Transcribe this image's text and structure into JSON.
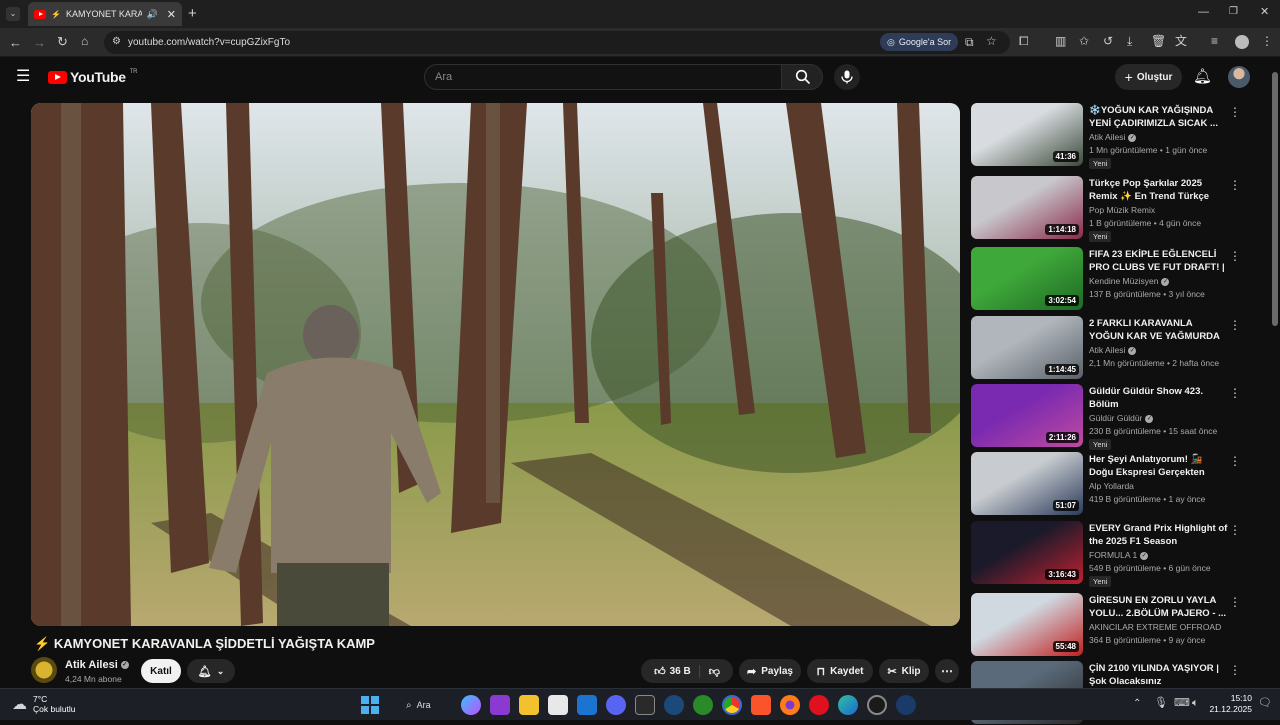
{
  "browser": {
    "tab_title": "KAMYONET KARAVANLA",
    "url": "youtube.com/watch?v=cupGZixFgTo",
    "google_ask_label": "Google'a Sor"
  },
  "youtube": {
    "logo_text": "YouTube",
    "region": "TR",
    "search_placeholder": "Ara",
    "create_label": "Oluştur"
  },
  "video": {
    "title_icon": "⚡",
    "title": "KAMYONET KARAVANLA ŞİDDETLİ YAĞIŞTA KAMP",
    "channel_name": "Atik Ailesi",
    "subscribers": "4,24 Mn abone",
    "join_label": "Katıl",
    "likes": "36 B",
    "share_label": "Paylaş",
    "save_label": "Kaydet",
    "clip_label": "Klip"
  },
  "recommendations": [
    {
      "title": "❄️YOĞUN KAR YAĞIŞINDA YENİ ÇADIRIMIZLA SICAK ...",
      "channel": "Atik Ailesi",
      "verified": true,
      "meta": "1 Mn görüntüleme • 1 gün önce",
      "badge": "Yeni",
      "duration": "41:36",
      "thumb_colors": [
        "#d8dce0",
        "#3c4a3a"
      ]
    },
    {
      "title": "Türkçe Pop Şarkılar 2025 Remix ✨ En Trend Türkçe Şarkılar ...",
      "channel": "Pop Müzik Remix",
      "verified": false,
      "meta": "1 B görüntüleme • 4 gün önce",
      "badge": "Yeni",
      "duration": "1:14:18",
      "thumb_colors": [
        "#c8c8cc",
        "#8a2a4a"
      ]
    },
    {
      "title": "FIFA 23 EKİPLE EĞLENCELİ PRO CLUBS VE FUT DRAFT! | ...",
      "channel": "Kendine Müzisyen",
      "verified": true,
      "meta": "137 B görüntüleme • 3 yıl önce",
      "badge": "",
      "duration": "3:02:54",
      "thumb_colors": [
        "#3fa83a",
        "#1e6a24"
      ]
    },
    {
      "title": "2 FARKLI KARAVANLA YOĞUN KAR VE YAĞMURDA KAMP",
      "channel": "Atik Ailesi",
      "verified": true,
      "meta": "2,1 Mn görüntüleme • 2 hafta önce",
      "badge": "",
      "duration": "1:14:45",
      "thumb_colors": [
        "#b0b6bc",
        "#5a6068"
      ]
    },
    {
      "title": "Güldür Güldür Show 423. Bölüm",
      "channel": "Güldür Güldür",
      "verified": true,
      "meta": "230 B görüntüleme • 15 saat önce",
      "badge": "Yeni",
      "duration": "2:11:26",
      "thumb_colors": [
        "#7a2ab0",
        "#c04aa0"
      ]
    },
    {
      "title": "Her Şeyi Anlatıyorum! 🚂 Doğu Ekspresi Gerçekten Değer mi? ...",
      "channel": "Alp Yollarda",
      "verified": false,
      "meta": "419 B görüntüleme • 1 ay önce",
      "badge": "",
      "duration": "51:07",
      "thumb_colors": [
        "#c8ccd0",
        "#2a3a5a"
      ]
    },
    {
      "title": "EVERY Grand Prix Highlight of the 2025 F1 Season",
      "channel": "FORMULA 1",
      "verified": true,
      "meta": "549 B görüntüleme • 6 gün önce",
      "badge": "Yeni",
      "duration": "3:16:43",
      "thumb_colors": [
        "#1a1a2a",
        "#c02030"
      ]
    },
    {
      "title": "GİRESUN EN ZORLU YAYLA YOLU... 2.BÖLÜM PAJERO - ...",
      "channel": "AKINCILAR EXTREME OFFROAD",
      "verified": false,
      "meta": "364 B görüntüleme • 9 ay önce",
      "badge": "",
      "duration": "55:48",
      "thumb_colors": [
        "#d0d8e0",
        "#c02020"
      ]
    },
    {
      "title": "ÇİN 2100 YILINDA YAŞIYOR | Şok Olacaksınız",
      "channel": "",
      "verified": false,
      "meta": "",
      "badge": "",
      "duration": "",
      "thumb_colors": [
        "#5a6a7a",
        "#2a2a2a"
      ]
    }
  ],
  "taskbar": {
    "temperature": "7°C",
    "weather": "Çok bulutlu",
    "search_label": "Ara",
    "time": "15:10",
    "date": "21.12.2025"
  },
  "colors": {
    "background": "#0f0f0f",
    "accent": "#ff0000",
    "pill": "#272727"
  }
}
